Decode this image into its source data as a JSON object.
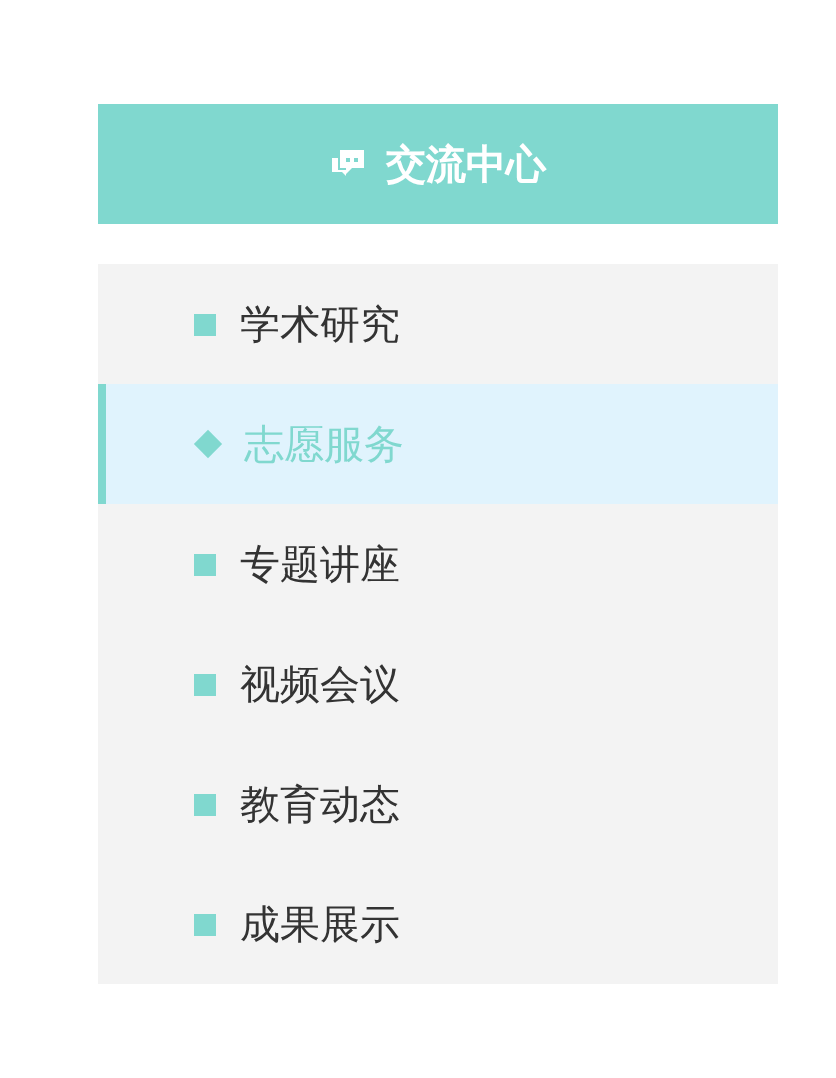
{
  "panel": {
    "title": "交流中心"
  },
  "items": [
    {
      "label": "学术研究",
      "selected": false
    },
    {
      "label": "志愿服务",
      "selected": true
    },
    {
      "label": "专题讲座",
      "selected": false
    },
    {
      "label": "视频会议",
      "selected": false
    },
    {
      "label": "教育动态",
      "selected": false
    },
    {
      "label": "成果展示",
      "selected": false
    }
  ]
}
